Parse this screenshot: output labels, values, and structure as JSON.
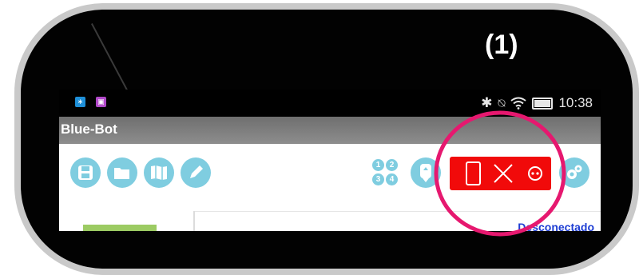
{
  "annotation_label": "(1)",
  "status_bar": {
    "time": "10:38",
    "icons": [
      "bluetooth-icon",
      "vibrate-off-icon",
      "wifi-icon",
      "battery-icon"
    ]
  },
  "app_bar": {
    "title": "Blue-Bot"
  },
  "toolbar": {
    "left_buttons": [
      "save-icon",
      "open-folder-icon",
      "map-icon",
      "pencil-icon"
    ],
    "number_badges": [
      "1",
      "2",
      "3",
      "4"
    ],
    "connection_button": {
      "icons": [
        "tablet-icon",
        "close-x-icon",
        "blue-bot-icon"
      ],
      "color": "#f10a0a"
    },
    "right_buttons": [
      "robot-step-icon",
      "settings-icon"
    ]
  },
  "connection_status": "Desconectado",
  "colors": {
    "accent_blue": "#7fcde0",
    "connect_red": "#f10a0a",
    "highlight_pink": "#e6186f",
    "status_blue": "#1e3ed4"
  }
}
